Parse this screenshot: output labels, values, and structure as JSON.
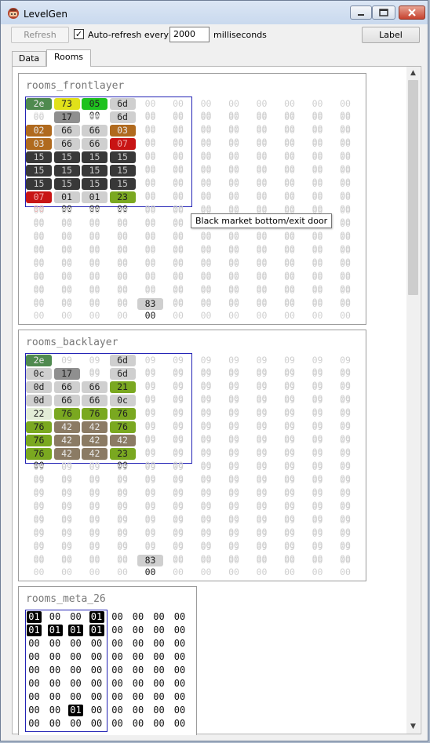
{
  "window": {
    "title": "LevelGen",
    "icon": "spelunker-head-icon"
  },
  "toolbar": {
    "refresh_label": "Refresh",
    "autorefresh_label": "Auto-refresh every",
    "autorefresh_checked": true,
    "interval_value": "2000",
    "interval_unit": "milliseconds",
    "label_button": "Label"
  },
  "tabs": [
    {
      "label": "Data",
      "active": false
    },
    {
      "label": "Rooms",
      "active": true
    }
  ],
  "colors": {
    "pale": "#cfcfcf",
    "dark_green": "#4f8a4f",
    "yellow": "#e1e11a",
    "bright_green": "#1ec21e",
    "light_gray": "#cfcfcf",
    "mid_gray": "#8f8f8f",
    "brown_orange": "#b06a1e",
    "red": "#c81414",
    "near_black": "#383838",
    "olive_green": "#7aa820",
    "pale_green": "#e2ecd6",
    "brown_gray": "#8b7b64",
    "black": "#000000",
    "highlight_border": "#2323b5"
  },
  "tooltip": "Black market bottom/exit door",
  "panels": [
    {
      "title": "rooms_frontlayer",
      "rows": [
        [
          "2e 00",
          "73 00",
          "05 00",
          "6d 00",
          "00 00",
          "00 00",
          "00 00",
          "00 00",
          "00 00",
          "00 00",
          "00 00",
          "00 00"
        ],
        [
          "00 00",
          "17 00",
          "00 00",
          "6d 00",
          "00 00",
          "00 00",
          "00 00",
          "00 00",
          "00 00",
          "00 00",
          "00 00",
          "00 00"
        ],
        [
          "02 00",
          "66 00",
          "66 00",
          "03 00",
          "00 00",
          "00 00",
          "00 00",
          "00 00",
          "00 00",
          "00 00",
          "00 00",
          "00 00"
        ],
        [
          "03 00",
          "66 00",
          "66 00",
          "07 00",
          "00 00",
          "00 00",
          "00 00",
          "00 00",
          "00 00",
          "00 00",
          "00 00",
          "00 00"
        ],
        [
          "15 00",
          "15 00",
          "15 00",
          "15 00",
          "00 00",
          "00 00",
          "00 00",
          "00 00",
          "00 00",
          "00 00",
          "00 00",
          "00 00"
        ],
        [
          "15 00",
          "15 00",
          "15 00",
          "15 00",
          "00 00",
          "00 00",
          "00 00",
          "00 00",
          "00 00",
          "00 00",
          "00 00",
          "00 00"
        ],
        [
          "15 00",
          "15 00",
          "15 00",
          "15 00",
          "00 00",
          "00 00",
          "00 00",
          "00 00",
          "00 00",
          "00 00",
          "00 00",
          "00 00"
        ],
        [
          "07 00",
          "01 00",
          "01 00",
          "23 00",
          "00 00",
          "00 00",
          "00 00",
          "00 00",
          "00 00",
          "00 00",
          "00 00",
          "00 00"
        ],
        [
          "00 00",
          "00 00",
          "00 00",
          "00 00",
          "00 00",
          "00 00",
          "00 00",
          "00 00",
          "00 00",
          "00 00",
          "00 00",
          "00 00"
        ],
        [
          "00 00",
          "00 00",
          "00 00",
          "00 00",
          "00 00",
          "00 00",
          "00 00",
          "00 00",
          "00 00",
          "00 00",
          "00 00",
          "00 00"
        ],
        [
          "00 00",
          "00 00",
          "00 00",
          "00 00",
          "00 00",
          "00 00",
          "00 00",
          "00 00",
          "00 00",
          "00 00",
          "00 00",
          "00 00"
        ],
        [
          "00 00",
          "00 00",
          "00 00",
          "00 00",
          "00 00",
          "00 00",
          "00 00",
          "00 00",
          "00 00",
          "00 00",
          "00 00",
          "00 00"
        ],
        [
          "00 00",
          "00 00",
          "00 00",
          "00 00",
          "00 00",
          "00 00",
          "00 00",
          "00 00",
          "00 00",
          "00 00",
          "00 00",
          "00 00"
        ],
        [
          "00 00",
          "00 00",
          "00 00",
          "00 00",
          "00 00",
          "00 00",
          "00 00",
          "00 00",
          "00 00",
          "00 00",
          "00 00",
          "00 00"
        ],
        [
          "00 00",
          "00 00",
          "00 00",
          "00 00",
          "00 00",
          "00 00",
          "00 00",
          "00 00",
          "00 00",
          "00 00",
          "00 00",
          "00 00"
        ],
        [
          "00 00",
          "00 00",
          "00 00",
          "00 00",
          "83 00",
          "00 00",
          "00 00",
          "00 00",
          "00 00",
          "00 00",
          "00 00",
          "00 00"
        ]
      ],
      "cell_colors": [
        [
          "dark_green",
          "yellow",
          "bright_green",
          "light_gray"
        ],
        [
          "pale",
          "mid_gray",
          "pale",
          "light_gray"
        ],
        [
          "brown_orange",
          "light_gray",
          "light_gray",
          "brown_orange"
        ],
        [
          "brown_orange",
          "light_gray",
          "light_gray",
          "red"
        ],
        [
          "near_black",
          "near_black",
          "near_black",
          "near_black"
        ],
        [
          "near_black",
          "near_black",
          "near_black",
          "near_black"
        ],
        [
          "near_black",
          "near_black",
          "near_black",
          "near_black"
        ],
        [
          "red",
          "light_gray",
          "light_gray",
          "olive_green"
        ]
      ],
      "special_cell": {
        "row": 15,
        "col": 4,
        "color": "light_gray"
      }
    },
    {
      "title": "rooms_backlayer",
      "rows": [
        [
          "2e 00",
          "09 00",
          "09 00",
          "6d 00",
          "09 00",
          "09 00",
          "09 00",
          "09 00",
          "09 00",
          "09 00",
          "09 00",
          "09 00"
        ],
        [
          "0c 00",
          "17 00",
          "09 00",
          "6d 00",
          "09 00",
          "09 00",
          "09 00",
          "09 00",
          "09 00",
          "09 00",
          "09 00",
          "09 00"
        ],
        [
          "0d 00",
          "66 00",
          "66 00",
          "21 00",
          "09 00",
          "09 00",
          "09 00",
          "09 00",
          "09 00",
          "09 00",
          "09 00",
          "09 00"
        ],
        [
          "0d 00",
          "66 00",
          "66 00",
          "0c 00",
          "09 00",
          "09 00",
          "09 00",
          "09 00",
          "09 00",
          "09 00",
          "09 00",
          "09 00"
        ],
        [
          "22 00",
          "76 00",
          "76 00",
          "76 00",
          "09 00",
          "09 00",
          "09 00",
          "09 00",
          "09 00",
          "09 00",
          "09 00",
          "09 00"
        ],
        [
          "76 00",
          "42 00",
          "42 00",
          "76 00",
          "09 00",
          "09 00",
          "09 00",
          "09 00",
          "09 00",
          "09 00",
          "09 00",
          "09 00"
        ],
        [
          "76 00",
          "42 00",
          "42 00",
          "42 00",
          "09 00",
          "09 00",
          "09 00",
          "09 00",
          "09 00",
          "09 00",
          "09 00",
          "09 00"
        ],
        [
          "76 00",
          "42 00",
          "42 00",
          "23 00",
          "09 00",
          "09 00",
          "09 00",
          "09 00",
          "09 00",
          "09 00",
          "09 00",
          "09 00"
        ],
        [
          "09 00",
          "09 00",
          "09 00",
          "09 00",
          "09 00",
          "09 00",
          "09 00",
          "09 00",
          "09 00",
          "09 00",
          "09 00",
          "09 00"
        ],
        [
          "09 00",
          "09 00",
          "09 00",
          "09 00",
          "09 00",
          "09 00",
          "09 00",
          "09 00",
          "09 00",
          "09 00",
          "09 00",
          "09 00"
        ],
        [
          "09 00",
          "09 00",
          "09 00",
          "09 00",
          "09 00",
          "09 00",
          "09 00",
          "09 00",
          "09 00",
          "09 00",
          "09 00",
          "09 00"
        ],
        [
          "09 00",
          "09 00",
          "09 00",
          "09 00",
          "09 00",
          "09 00",
          "09 00",
          "09 00",
          "09 00",
          "09 00",
          "09 00",
          "09 00"
        ],
        [
          "09 00",
          "09 00",
          "09 00",
          "09 00",
          "09 00",
          "09 00",
          "09 00",
          "09 00",
          "09 00",
          "09 00",
          "09 00",
          "09 00"
        ],
        [
          "09 00",
          "09 00",
          "09 00",
          "09 00",
          "09 00",
          "09 00",
          "09 00",
          "09 00",
          "09 00",
          "09 00",
          "09 00",
          "09 00"
        ],
        [
          "09 00",
          "09 00",
          "09 00",
          "09 00",
          "09 00",
          "09 00",
          "09 00",
          "09 00",
          "09 00",
          "09 00",
          "09 00",
          "09 00"
        ],
        [
          "00 00",
          "00 00",
          "00 00",
          "00 00",
          "83 00",
          "00 00",
          "00 00",
          "00 00",
          "00 00",
          "00 00",
          "00 00",
          "00 00"
        ]
      ],
      "cell_colors": [
        [
          "dark_green",
          "pale",
          "pale",
          "light_gray"
        ],
        [
          "light_gray",
          "mid_gray",
          "pale",
          "light_gray"
        ],
        [
          "light_gray",
          "light_gray",
          "light_gray",
          "olive_green"
        ],
        [
          "light_gray",
          "light_gray",
          "light_gray",
          "light_gray"
        ],
        [
          "pale_green",
          "olive_green",
          "olive_green",
          "olive_green"
        ],
        [
          "olive_green",
          "brown_gray",
          "brown_gray",
          "olive_green"
        ],
        [
          "olive_green",
          "brown_gray",
          "brown_gray",
          "brown_gray"
        ],
        [
          "olive_green",
          "brown_gray",
          "brown_gray",
          "olive_green"
        ]
      ],
      "special_cell": {
        "row": 15,
        "col": 4,
        "color": "light_gray"
      }
    },
    {
      "title": "rooms_meta_26",
      "rows": [
        [
          "01",
          "00",
          "00",
          "01",
          "00",
          "00",
          "00",
          "00"
        ],
        [
          "01",
          "01",
          "01",
          "01",
          "00",
          "00",
          "00",
          "00"
        ],
        [
          "00",
          "00",
          "00",
          "00",
          "00",
          "00",
          "00",
          "00"
        ],
        [
          "00",
          "00",
          "00",
          "00",
          "00",
          "00",
          "00",
          "00"
        ],
        [
          "00",
          "00",
          "00",
          "00",
          "00",
          "00",
          "00",
          "00"
        ],
        [
          "00",
          "00",
          "00",
          "00",
          "00",
          "00",
          "00",
          "00"
        ],
        [
          "00",
          "00",
          "00",
          "00",
          "00",
          "00",
          "00",
          "00"
        ],
        [
          "00",
          "00",
          "01",
          "00",
          "00",
          "00",
          "00",
          "00"
        ],
        [
          "00",
          "00",
          "00",
          "00",
          "00",
          "00",
          "00",
          "00"
        ]
      ]
    }
  ]
}
